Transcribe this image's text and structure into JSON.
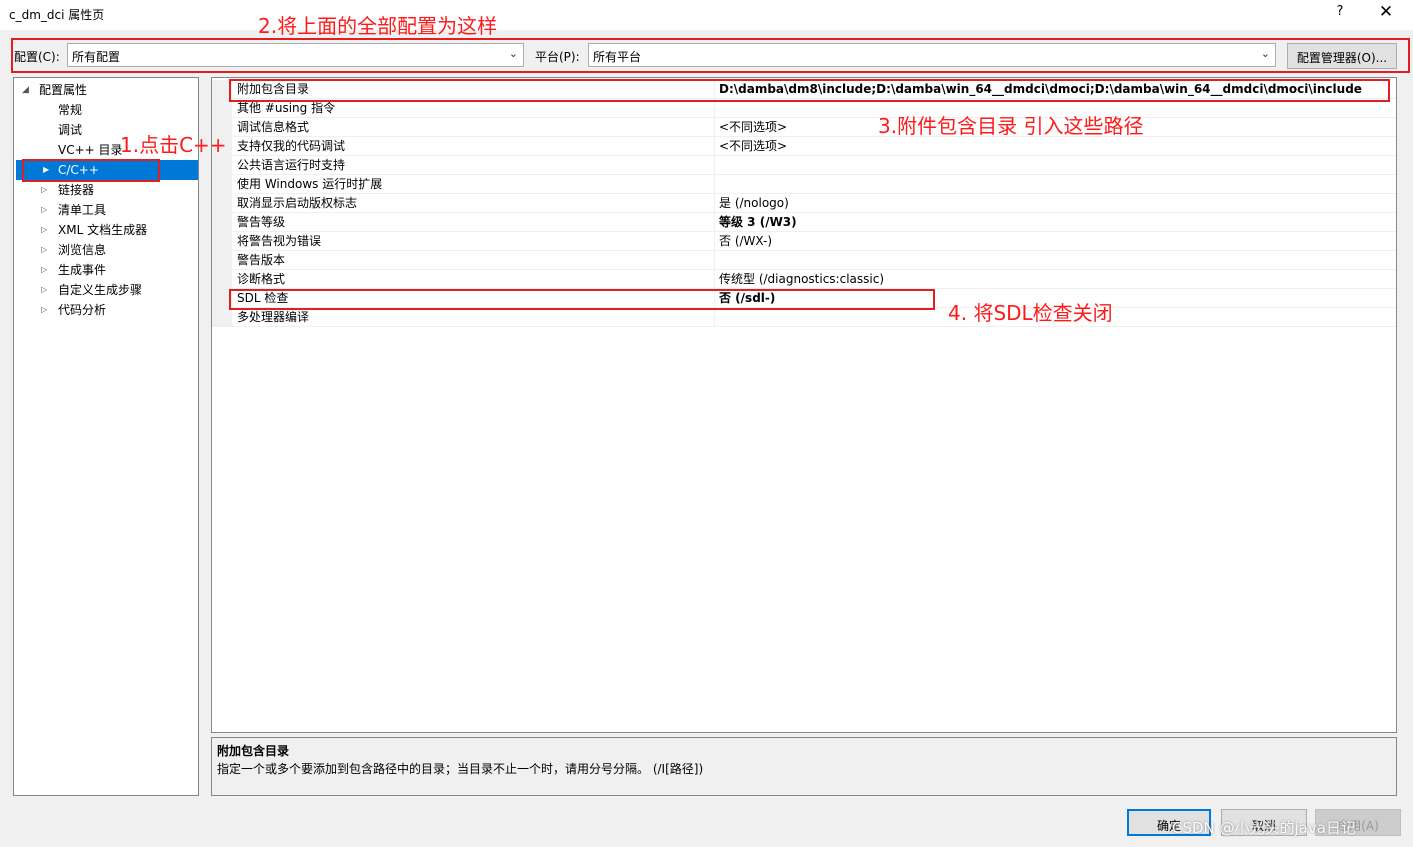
{
  "window": {
    "title": "c_dm_dci 属性页",
    "help_label": "?",
    "close_label": "✕"
  },
  "config_bar": {
    "config_label": "配置(C):",
    "config_value": "所有配置",
    "platform_label": "平台(P):",
    "platform_value": "所有平台",
    "manager_label": "配置管理器(O)..."
  },
  "tree": {
    "root": "配置属性",
    "items": [
      "常规",
      "调试",
      "VC++ 目录",
      "C/C++",
      "链接器",
      "清单工具",
      "XML 文档生成器",
      "浏览信息",
      "生成事件",
      "自定义生成步骤",
      "代码分析"
    ],
    "selected": "C/C++"
  },
  "properties": [
    {
      "name": "附加包含目录",
      "value": "D:\\damba\\dm8\\include;D:\\damba\\win_64__dmdci\\dmoci;D:\\damba\\win_64__dmdci\\dmoci\\include",
      "bold": true
    },
    {
      "name": "其他 #using 指令",
      "value": "",
      "bold": false
    },
    {
      "name": "调试信息格式",
      "value": "<不同选项>",
      "bold": false
    },
    {
      "name": "支持仅我的代码调试",
      "value": "<不同选项>",
      "bold": false
    },
    {
      "name": "公共语言运行时支持",
      "value": "",
      "bold": false
    },
    {
      "name": "使用 Windows 运行时扩展",
      "value": "",
      "bold": false
    },
    {
      "name": "取消显示启动版权标志",
      "value": "是 (/nologo)",
      "bold": false
    },
    {
      "name": "警告等级",
      "value": "等级 3 (/W3)",
      "bold": true
    },
    {
      "name": "将警告视为错误",
      "value": "否 (/WX-)",
      "bold": false
    },
    {
      "name": "警告版本",
      "value": "",
      "bold": false
    },
    {
      "name": "诊断格式",
      "value": "传统型 (/diagnostics:classic)",
      "bold": false
    },
    {
      "name": "SDL 检查",
      "value": "否 (/sdl-)",
      "bold": true
    },
    {
      "name": "多处理器编译",
      "value": "",
      "bold": false
    }
  ],
  "description": {
    "title": "附加包含目录",
    "text": "指定一个或多个要添加到包含路径中的目录；当目录不止一个时，请用分号分隔。      (/I[路径])"
  },
  "buttons": {
    "ok": "确定",
    "cancel": "取消",
    "apply": "应用(A)"
  },
  "annotations": {
    "step1": "1.点击C++",
    "step2": "2.将上面的全部配置为这样",
    "step3": "3.附件包含目录 引入这些路径",
    "step4": "4. 将SDL检查关闭",
    "color": "#ff1a1a"
  },
  "watermark": "CSDN @小光头的java日记"
}
